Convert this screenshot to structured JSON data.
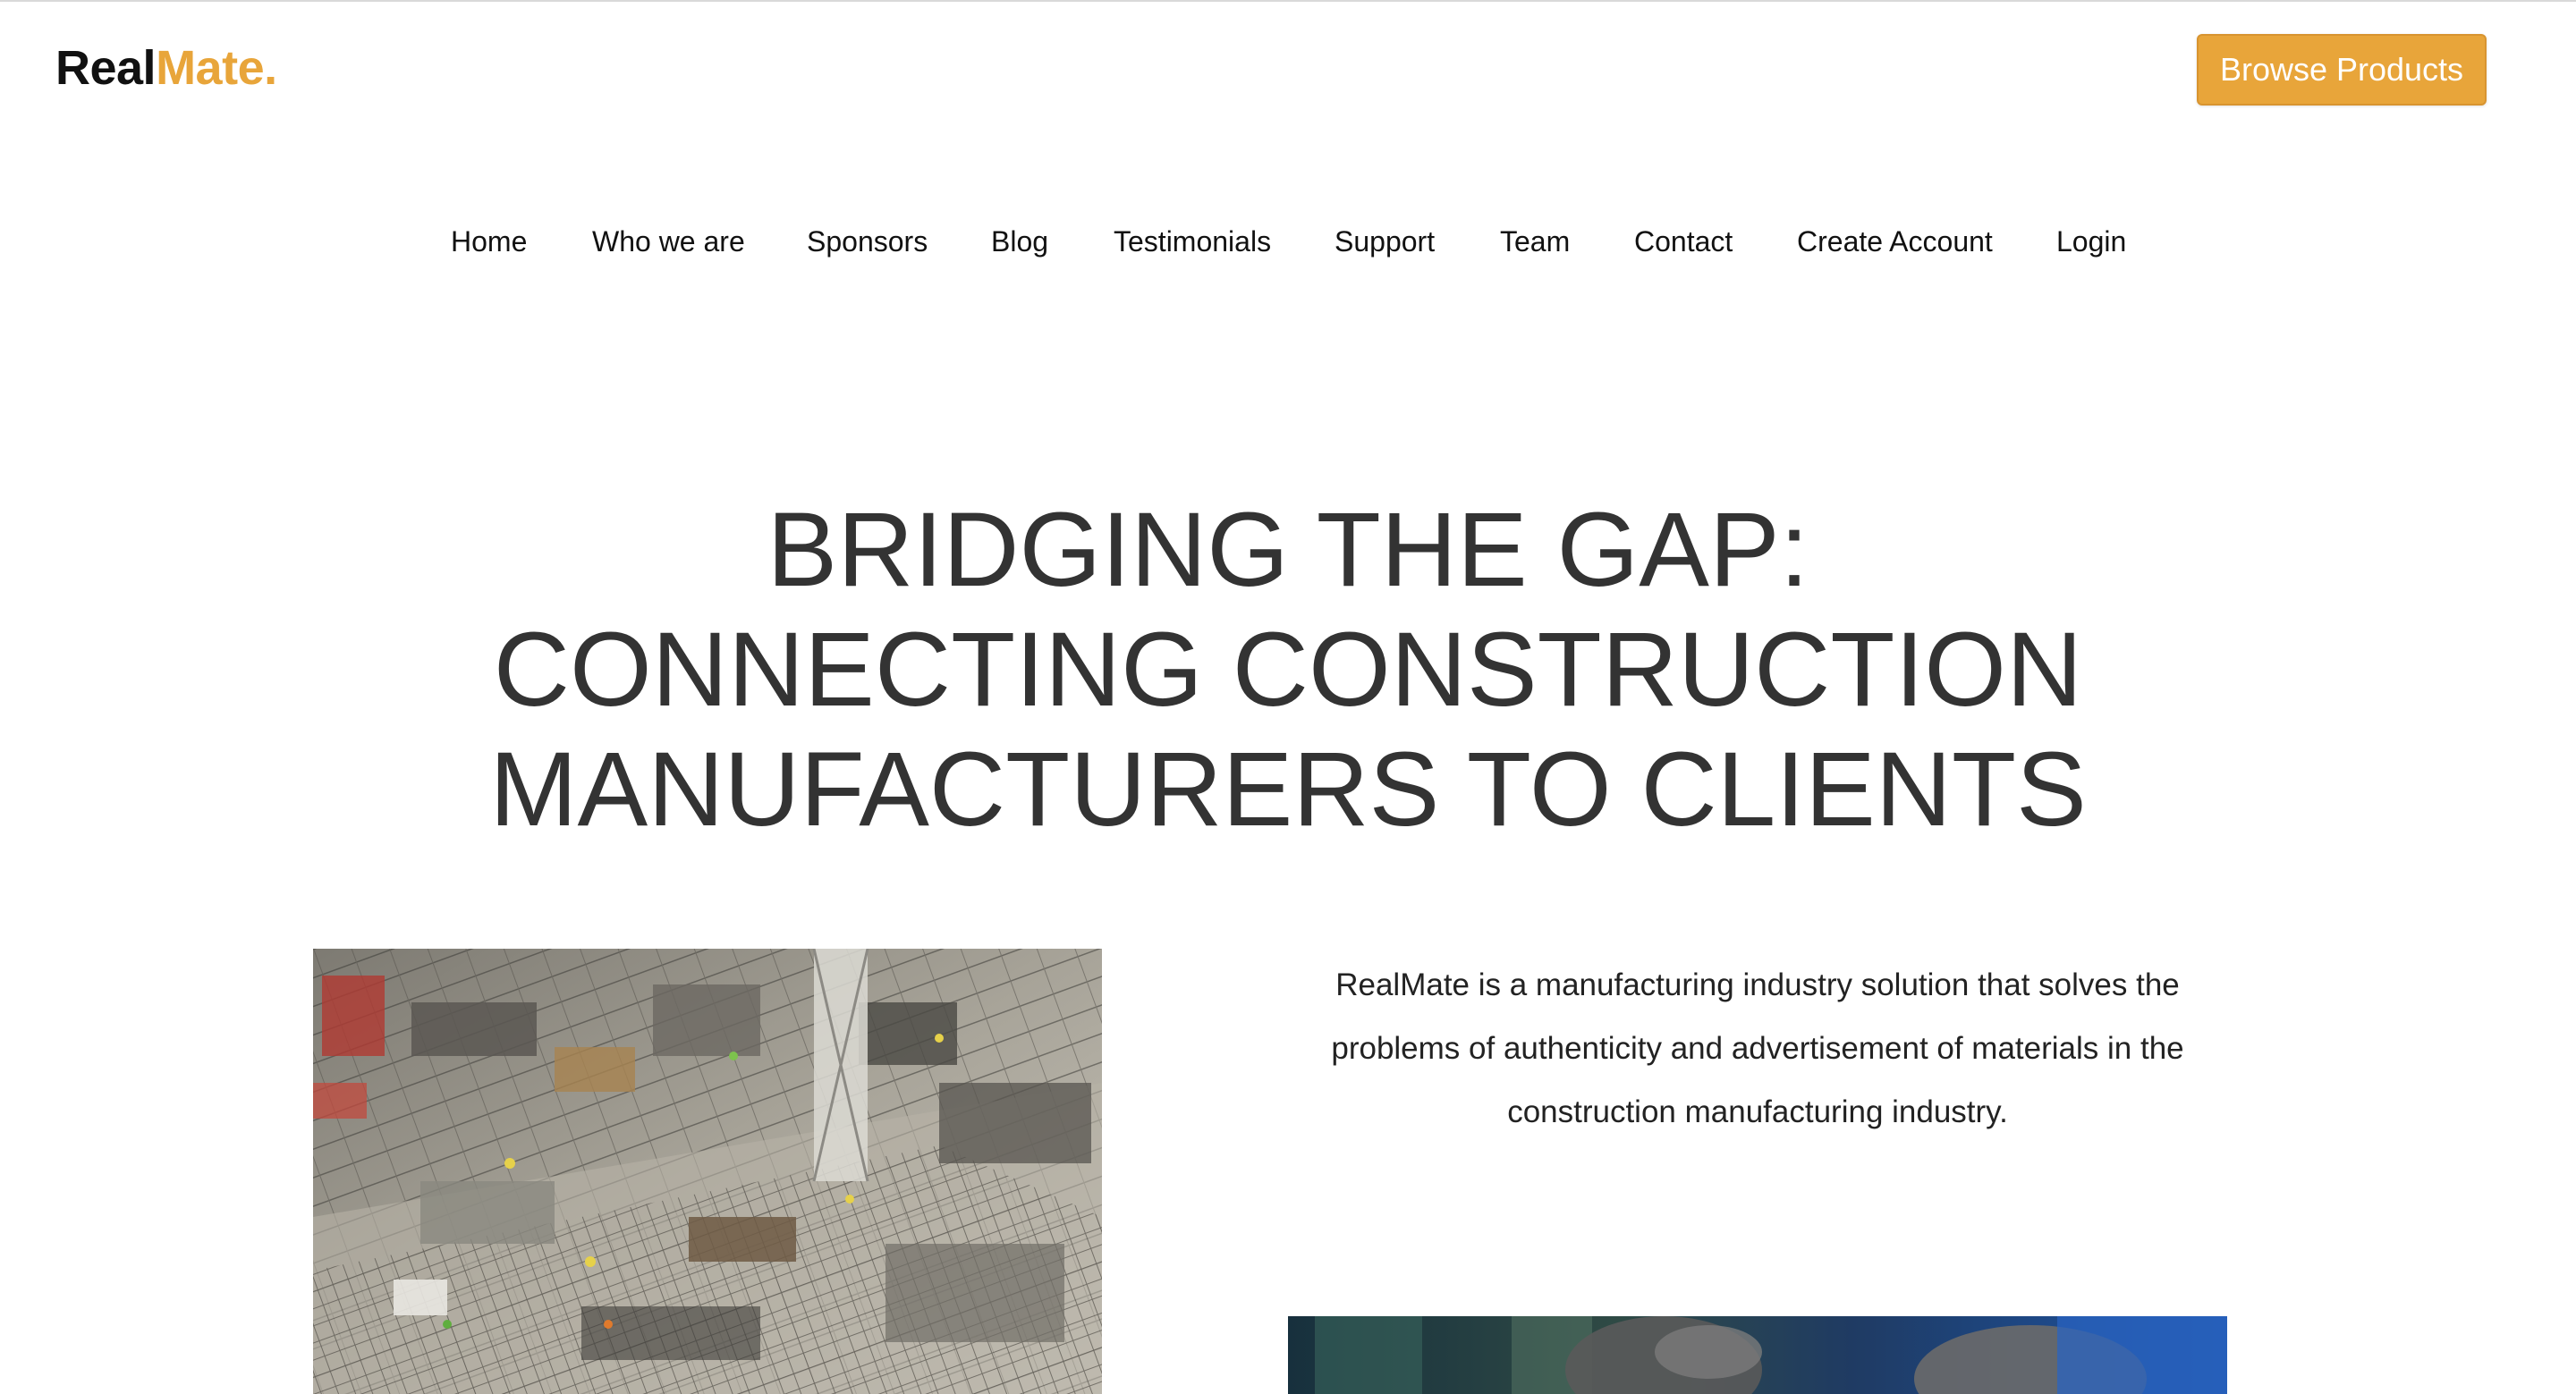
{
  "header": {
    "logo_primary": "Real",
    "logo_accent": "Mate.",
    "cta_label": "Browse Products"
  },
  "nav": {
    "items": [
      {
        "label": "Home"
      },
      {
        "label": "Who we are"
      },
      {
        "label": "Sponsors"
      },
      {
        "label": "Blog"
      },
      {
        "label": "Testimonials"
      },
      {
        "label": "Support"
      },
      {
        "label": "Team"
      },
      {
        "label": "Contact"
      },
      {
        "label": "Create Account"
      },
      {
        "label": "Login"
      }
    ]
  },
  "hero": {
    "title_lines": [
      "BRIDGING THE GAP:",
      "CONNECTING CONSTRUCTION",
      "MANUFACTURERS TO CLIENTS"
    ],
    "description": "RealMate is a manufacturing industry solution that solves the problems of authenticity and advertisement of materials in the construction manufacturing industry."
  },
  "colors": {
    "accent": "#e8a53a",
    "text_dark": "#111111",
    "heading": "#333333",
    "background": "#ffffff"
  },
  "images": {
    "hero_image": "construction-site-aerial-photo",
    "second_image": "worker-gloves-photo"
  }
}
